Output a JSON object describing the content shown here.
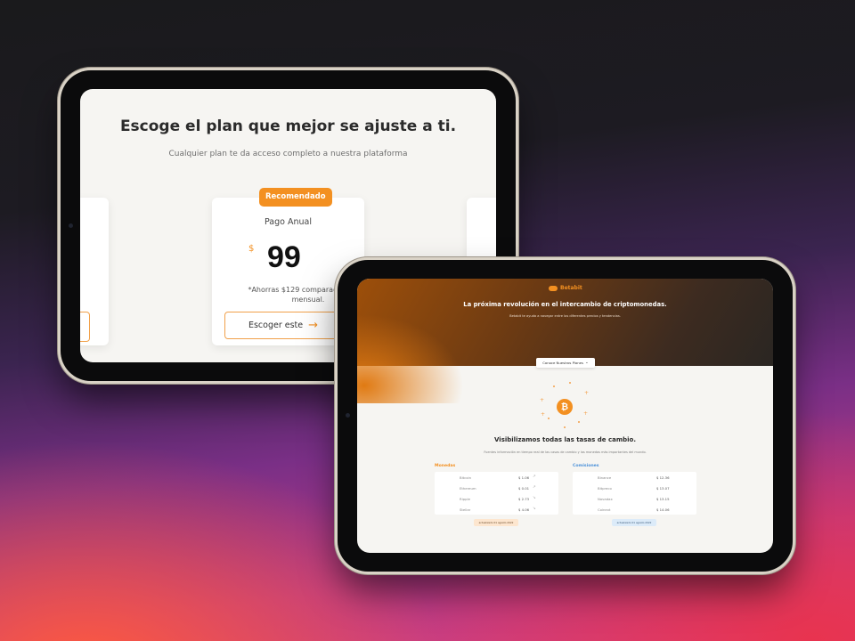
{
  "pricing": {
    "title": "Escoge el plan que mejor se ajuste a ti.",
    "subtitle": "Cualquier plan te da acceso completo a nuestra plataforma",
    "badge": "Recomendado",
    "plan_name": "Pago Anual",
    "currency": "$",
    "price": "99",
    "note": "*Ahorras $129 comparado al plan mensual.",
    "cta": "Escoger este",
    "cta_icon": "arrow-right-icon"
  },
  "landing": {
    "logo_text": "Betabit",
    "hero_title": "La próxima revolución en el intercambio de criptomonedas.",
    "hero_subtitle": "Betabit te ayuda a navegar entre los diferentes precios y tendencias.",
    "plans_button": "Conoce Nuestros Planes",
    "section_title": "Visibilizamos todas las tasas de cambio.",
    "section_subtitle": "Fuentes información en tiempo real de las casas de cambio y las monedas más importantes del mundo.",
    "monedas": {
      "label": "Monedas",
      "color": "#f39021",
      "rows": [
        {
          "name": "Bitcoin",
          "value": "$ 1.06",
          "trend": "↗"
        },
        {
          "name": "Ethereum",
          "value": "$ 0.01",
          "trend": "↗"
        },
        {
          "name": "Ripple",
          "value": "$ 2.73",
          "trend": "↘"
        },
        {
          "name": "Stellar",
          "value": "$ 4.06",
          "trend": "↘"
        }
      ],
      "stamp": "actualizado 01 agosto 2022"
    },
    "comisiones": {
      "label": "Comisiones",
      "color": "#4a90d9",
      "rows": [
        {
          "name": "Binance",
          "value": "$ 12.36"
        },
        {
          "name": "Bitpreco",
          "value": "$ 13.07"
        },
        {
          "name": "Novadax",
          "value": "$ 13.15"
        },
        {
          "name": "Coinext",
          "value": "$ 14.06"
        }
      ],
      "stamp": "actualizado 01 agosto 2022"
    }
  }
}
